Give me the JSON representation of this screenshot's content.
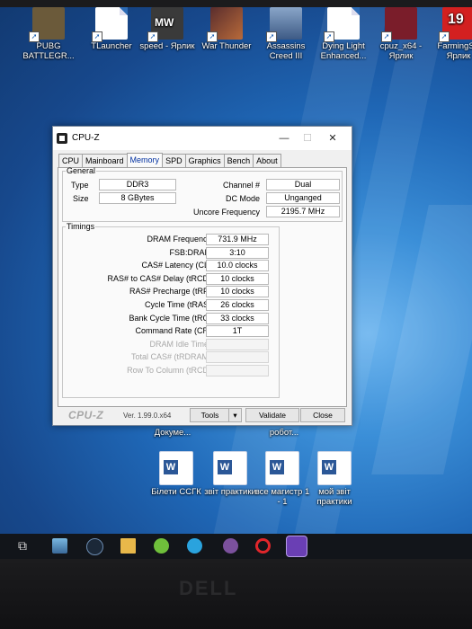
{
  "desktop_icons_top": [
    {
      "label": "PUBG BATTLEGR...",
      "icon": "pubg-icon"
    },
    {
      "label": "TLauncher",
      "icon": "tlauncher-icon"
    },
    {
      "label": "speed - Ярлик",
      "icon": "nfs-mw-icon",
      "badge": "MW"
    },
    {
      "label": "War Thunder",
      "icon": "war-thunder-icon"
    },
    {
      "label": "Assassins Creed III",
      "icon": "assassins-creed-icon"
    },
    {
      "label": "Dying Light Enhanced...",
      "icon": "dying-light-icon"
    },
    {
      "label": "cpuz_x64 - Ярлик",
      "icon": "cpuz-icon"
    },
    {
      "label": "FarmingS - Ярлик",
      "icon": "farming-simulator-icon",
      "badge": "19"
    }
  ],
  "desktop_icons_partial": [
    {
      "label": "Докуме..."
    },
    {
      "label": "робот..."
    }
  ],
  "desktop_icons_bottom": [
    {
      "label": "Білети ССГК",
      "icon": "word-doc-icon"
    },
    {
      "label": "звіт практики",
      "icon": "word-doc-icon"
    },
    {
      "label": "все магистр 1 - 1",
      "icon": "word-doc-icon"
    },
    {
      "label": "мой звіт практики",
      "icon": "word-doc-icon"
    }
  ],
  "window": {
    "title": "CPU-Z",
    "tabs": [
      "CPU",
      "Mainboard",
      "Memory",
      "SPD",
      "Graphics",
      "Bench",
      "About"
    ],
    "active_tab": "Memory",
    "general": {
      "legend": "General",
      "type_label": "Type",
      "type_value": "DDR3",
      "size_label": "Size",
      "size_value": "8 GBytes",
      "channel_label": "Channel #",
      "channel_value": "Dual",
      "dcmode_label": "DC Mode",
      "dcmode_value": "Unganged",
      "uncore_label": "Uncore Frequency",
      "uncore_value": "2195.7 MHz"
    },
    "timings": {
      "legend": "Timings",
      "rows": [
        {
          "label": "DRAM Frequency",
          "value": "731.9 MHz",
          "enabled": true
        },
        {
          "label": "FSB:DRAM",
          "value": "3:10",
          "enabled": true
        },
        {
          "label": "CAS# Latency (CL)",
          "value": "10.0 clocks",
          "enabled": true
        },
        {
          "label": "RAS# to CAS# Delay (tRCD)",
          "value": "10 clocks",
          "enabled": true
        },
        {
          "label": "RAS# Precharge (tRP)",
          "value": "10 clocks",
          "enabled": true
        },
        {
          "label": "Cycle Time (tRAS)",
          "value": "26 clocks",
          "enabled": true
        },
        {
          "label": "Bank Cycle Time (tRC)",
          "value": "33 clocks",
          "enabled": true
        },
        {
          "label": "Command Rate (CR)",
          "value": "1T",
          "enabled": true
        },
        {
          "label": "DRAM Idle Timer",
          "value": "",
          "enabled": false
        },
        {
          "label": "Total CAS# (tRDRAM)",
          "value": "",
          "enabled": false
        },
        {
          "label": "Row To Column (tRCD)",
          "value": "",
          "enabled": false
        }
      ]
    },
    "statusbar": {
      "brand": "CPU-Z",
      "version": "Ver. 1.99.0.x64",
      "tools_label": "Tools",
      "validate_label": "Validate",
      "close_label": "Close"
    }
  },
  "taskbar": {
    "icons": [
      "task-view-icon",
      "ship-game-icon",
      "steam-icon",
      "file-explorer-icon",
      "utorrent-icon",
      "telegram-icon",
      "viber-icon",
      "opera-icon",
      "game-app-icon"
    ]
  },
  "monitor_brand": "DELL"
}
